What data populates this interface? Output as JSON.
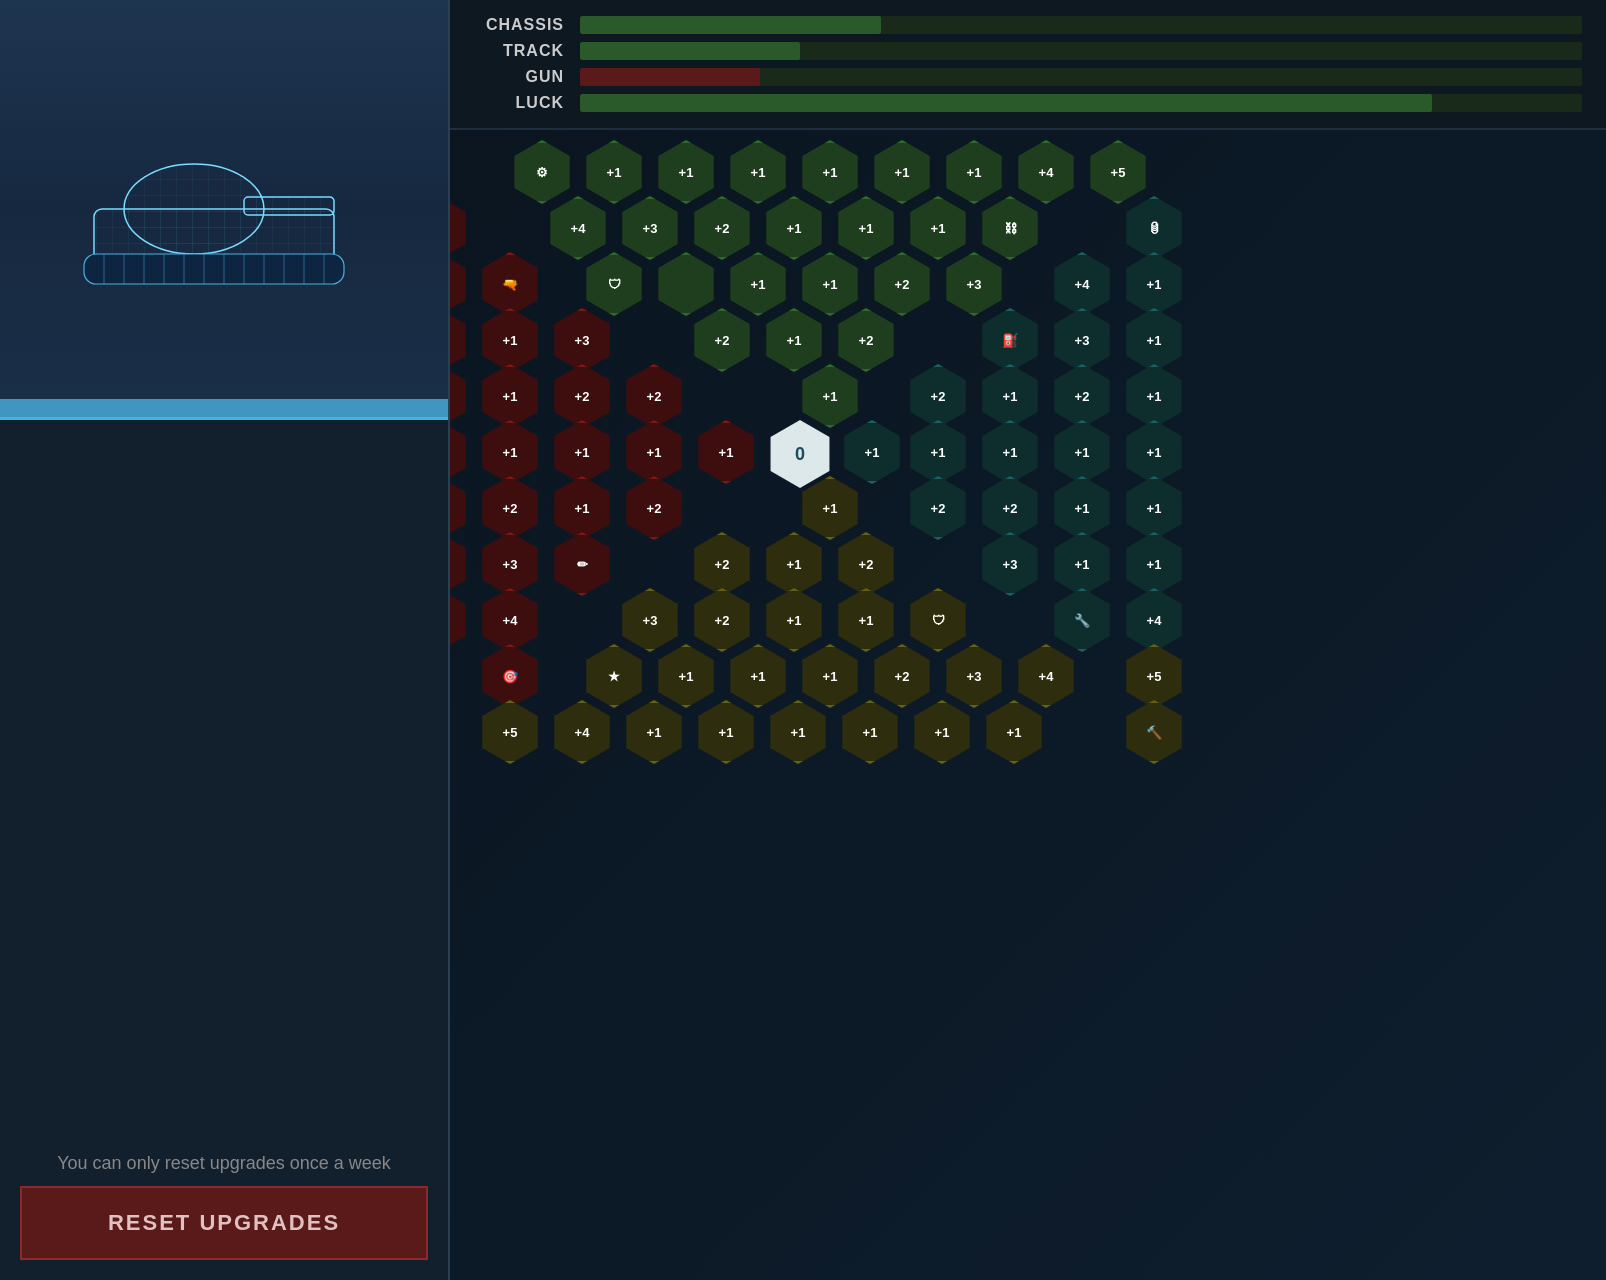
{
  "leftPanel": {
    "tankAlt": "Tank silhouette",
    "resetWarning": "You can only reset upgrades once a week",
    "resetButton": "RESET UPGRADES"
  },
  "stats": {
    "items": [
      {
        "label": "CHASSIS",
        "fillClass": "chassis",
        "width": 30
      },
      {
        "label": "TRACK",
        "fillClass": "track",
        "width": 22
      },
      {
        "label": "GUN",
        "fillClass": "gun",
        "width": 18
      },
      {
        "label": "LUCK",
        "fillClass": "luck",
        "width": 85
      }
    ]
  },
  "grid": {
    "centerValue": "0"
  }
}
